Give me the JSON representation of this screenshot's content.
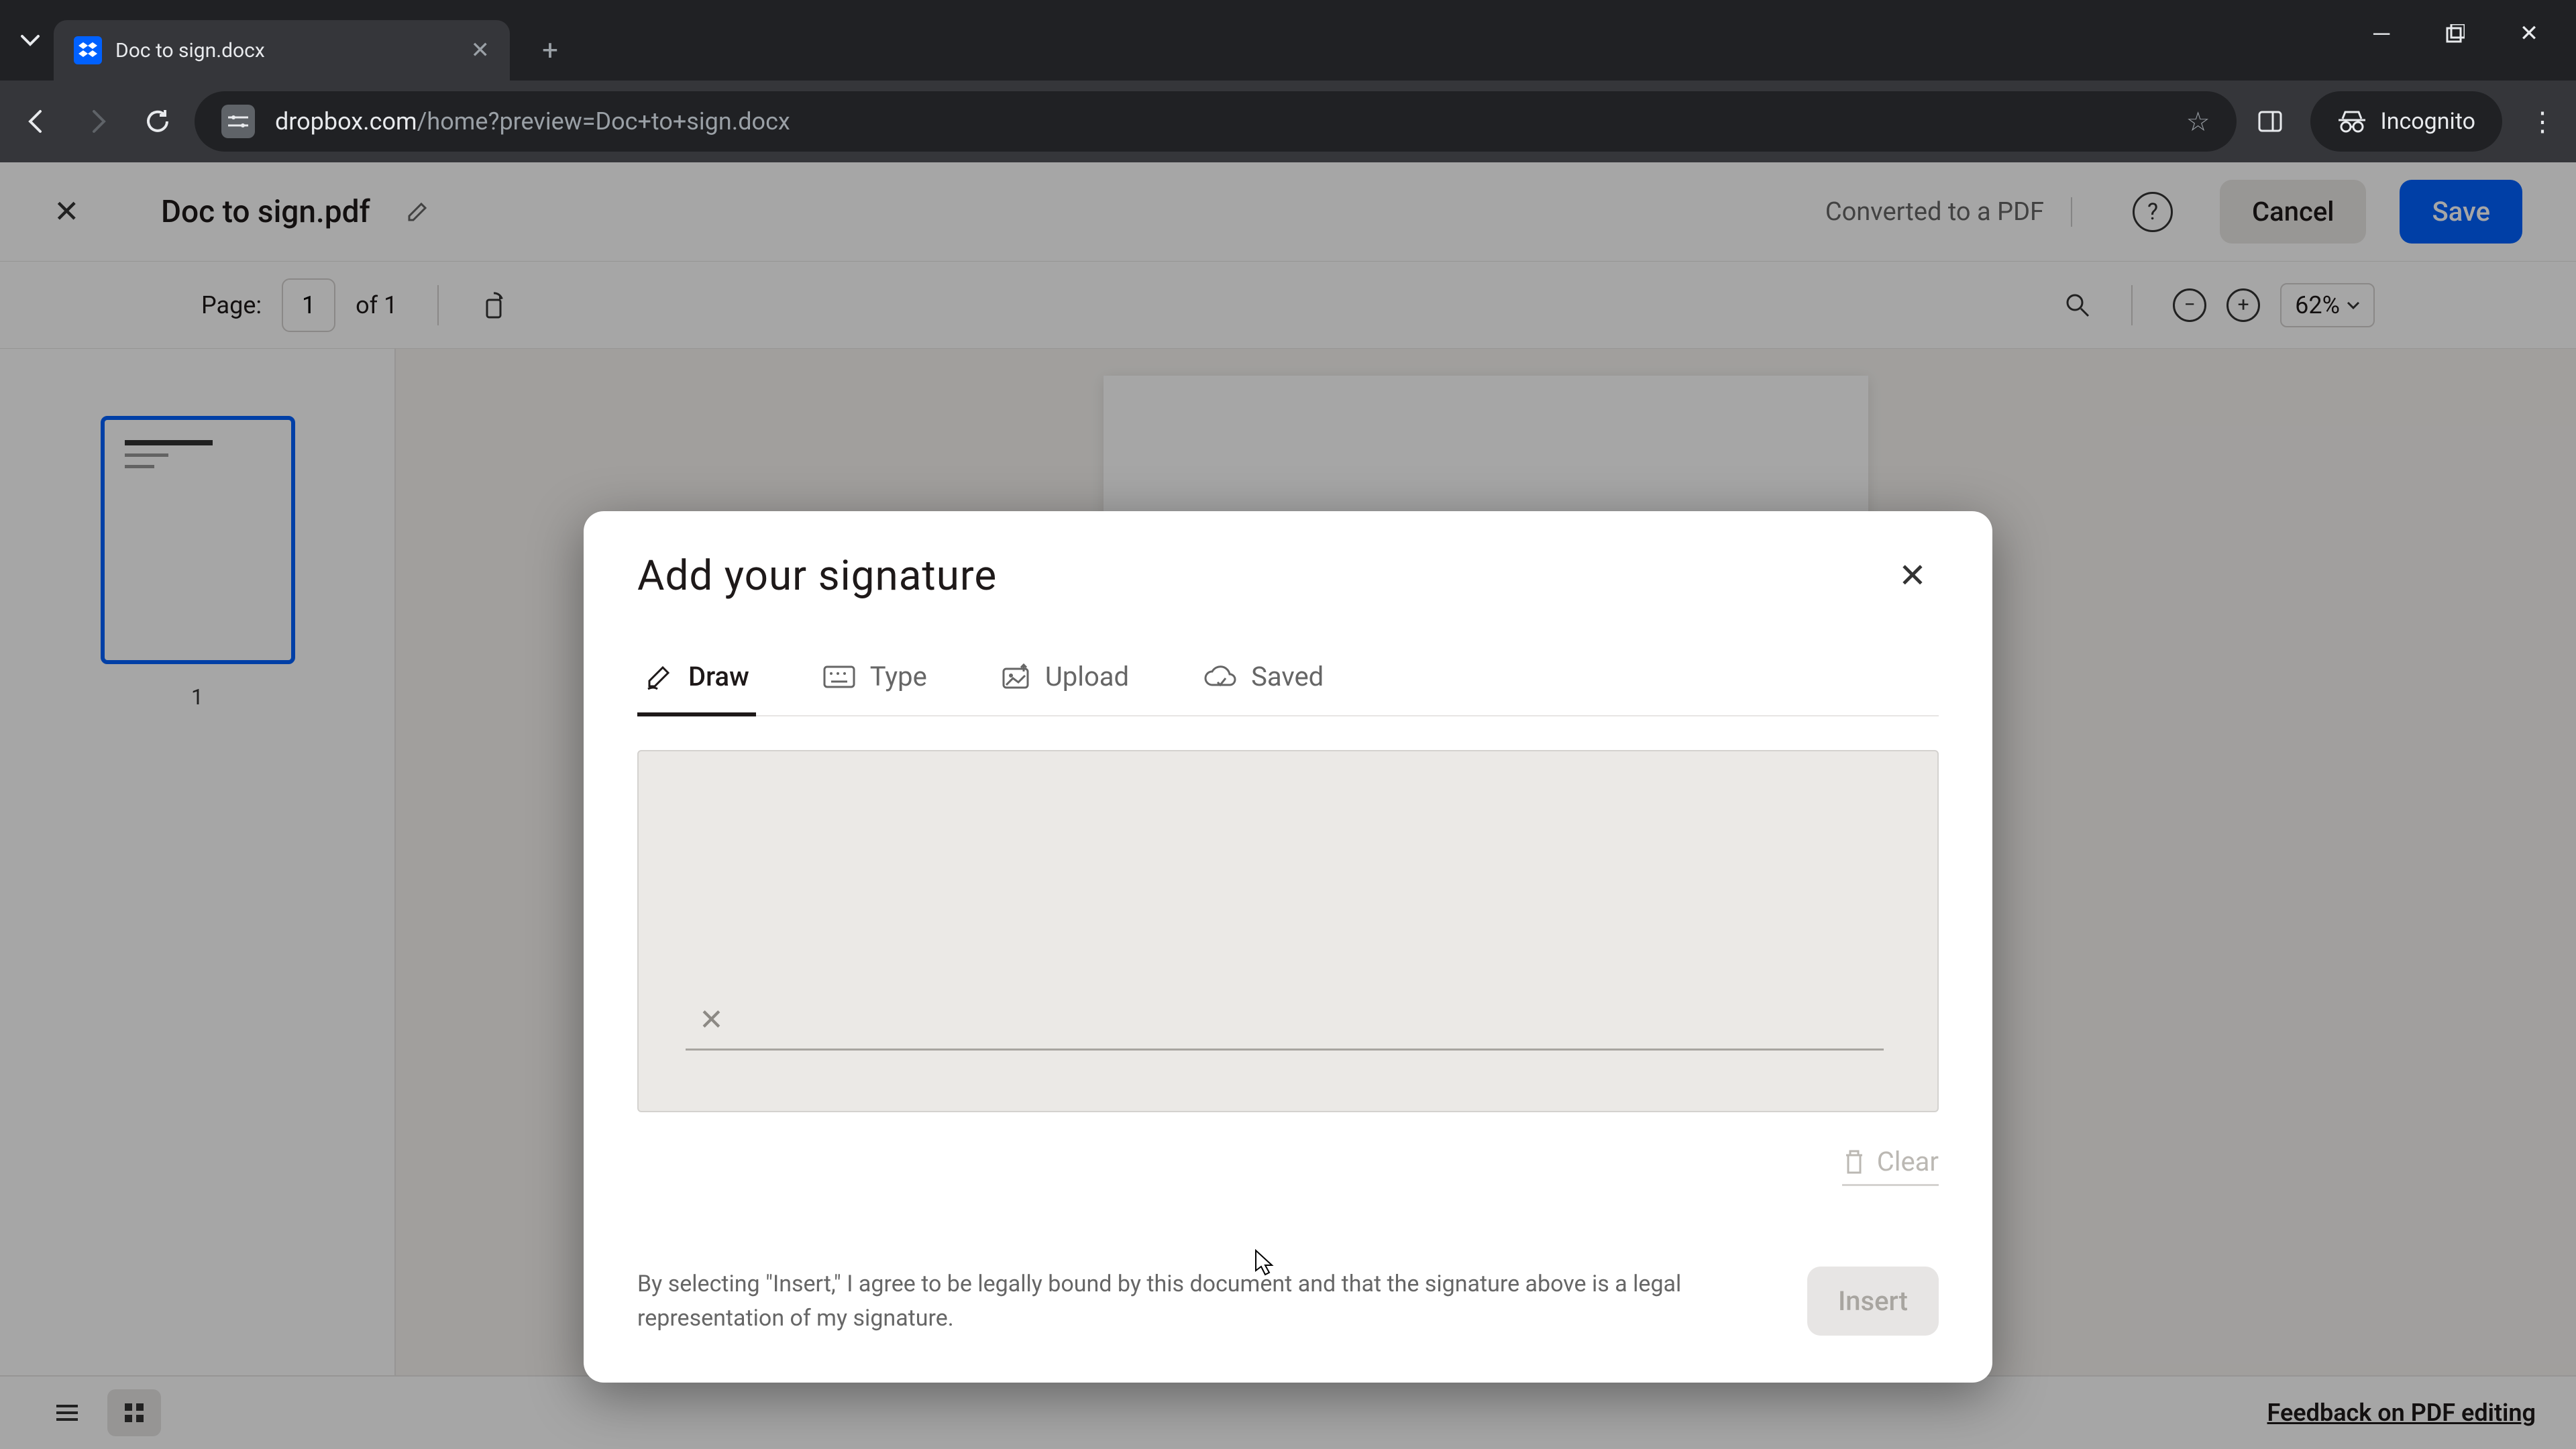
{
  "browser": {
    "tab_title": "Doc to sign.docx",
    "url_domain": "dropbox.com",
    "url_path": "/home?preview=Doc+to+sign.docx",
    "incognito_label": "Incognito"
  },
  "editor": {
    "doc_title": "Doc to sign.pdf",
    "converted_label": "Converted to a PDF",
    "cancel_label": "Cancel",
    "save_label": "Save",
    "page_label": "Page:",
    "page_current": "1",
    "page_total": "of 1",
    "zoom_level": "62%",
    "thumb_label": "1",
    "feedback_label": "Feedback on PDF editing"
  },
  "modal": {
    "title": "Add your signature",
    "tabs": {
      "draw": "Draw",
      "type": "Type",
      "upload": "Upload",
      "saved": "Saved"
    },
    "clear_label": "Clear",
    "legal_text": "By selecting \"Insert,\" I agree to be legally bound by this document and that the signature above is a legal representation of my signature.",
    "insert_label": "Insert"
  }
}
